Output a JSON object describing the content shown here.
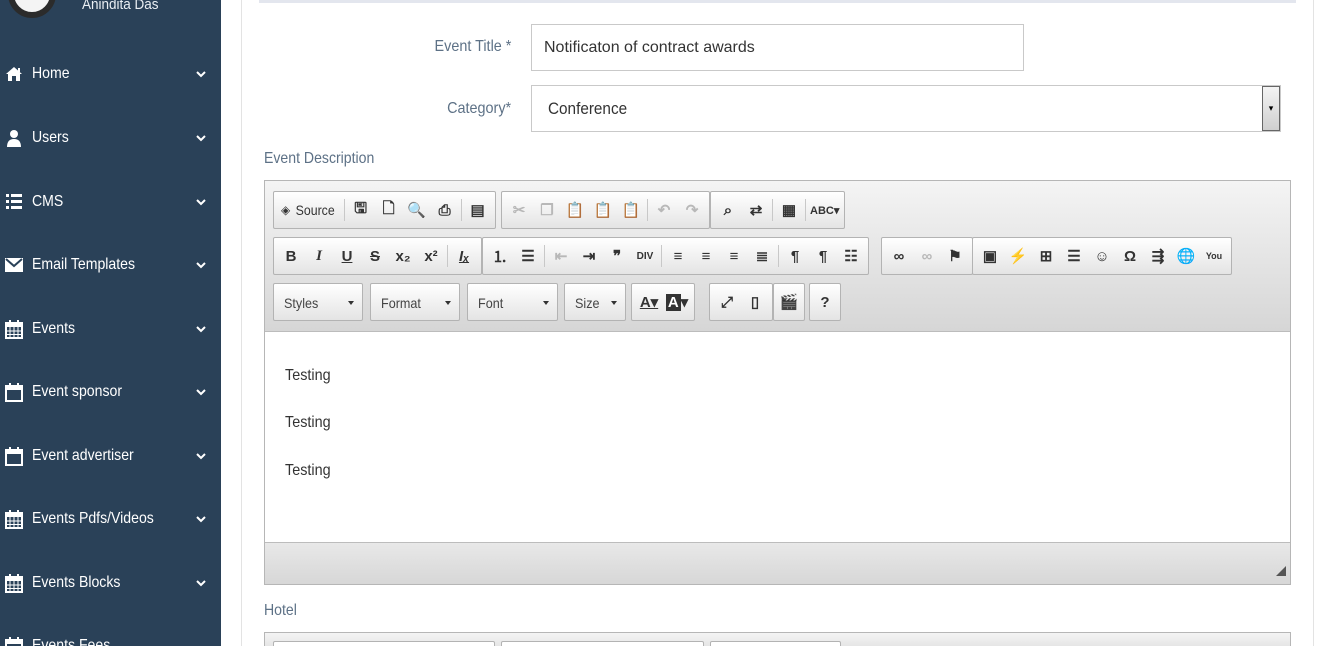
{
  "sidebar": {
    "user_name": "Anindita Das",
    "items": [
      {
        "label": "Home",
        "icon": "home-icon"
      },
      {
        "label": "Users",
        "icon": "user-icon"
      },
      {
        "label": "CMS",
        "icon": "list-icon"
      },
      {
        "label": "Email Templates",
        "icon": "envelope-icon"
      },
      {
        "label": "Events",
        "icon": "calendar-icon"
      },
      {
        "label": "Event sponsor",
        "icon": "calendar-blank-icon"
      },
      {
        "label": "Event advertiser",
        "icon": "calendar-blank-icon"
      },
      {
        "label": "Events Pdfs/Videos",
        "icon": "calendar-icon"
      },
      {
        "label": "Events Blocks",
        "icon": "calendar-icon"
      },
      {
        "label": "Events Fees",
        "icon": "calendar-icon"
      }
    ]
  },
  "form": {
    "event_title_label": "Event Title *",
    "event_title_value": "Notificaton of contract awards",
    "category_label": "Category*",
    "category_value": "Conference",
    "event_description_label": "Event Description",
    "hotel_label": "Hotel"
  },
  "editor": {
    "source_label": "Source",
    "styles_label": "Styles",
    "format_label": "Format",
    "font_label": "Font",
    "size_label": "Size",
    "help_label": "?",
    "content": [
      "Testing",
      "Testing",
      "Testing"
    ]
  },
  "colors": {
    "sidebar_bg": "#2a4158",
    "label_color": "#5d7186"
  }
}
